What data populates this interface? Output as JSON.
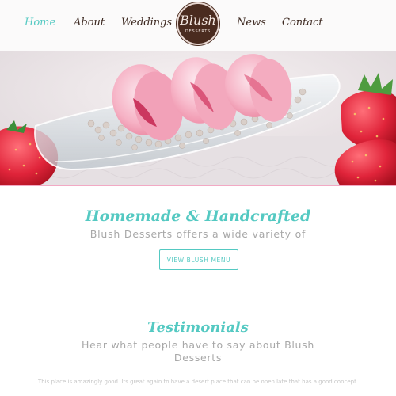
{
  "nav": {
    "items": [
      {
        "label": "Home",
        "active": true
      },
      {
        "label": "About",
        "active": false
      },
      {
        "label": "Weddings",
        "active": false
      },
      {
        "label": "News",
        "active": false
      },
      {
        "label": "Contact",
        "active": false
      }
    ],
    "logo": {
      "word": "Blush",
      "sub": "DESSERTS"
    }
  },
  "hero": {
    "alt": "Pink macarons on a glass dish with strawberries"
  },
  "intro": {
    "headline": "Homemade & Handcrafted",
    "subline": "Blush Desserts offers a wide variety of",
    "button_label": "VIEW BLUSH MENU"
  },
  "testimonials": {
    "title": "Testimonials",
    "subtitle_line1": "Hear what people have to say about Blush",
    "subtitle_line2": "Desserts",
    "quote": "This place is amazingly good. Its great again to have a desert place that can be open late that has a good concept."
  },
  "colors": {
    "accent": "#54c9c2",
    "logo_bg": "#4a2b1f",
    "nav_text": "#3e2a22",
    "muted_text": "#a8a8a8",
    "hero_border": "#f2a9c4"
  }
}
